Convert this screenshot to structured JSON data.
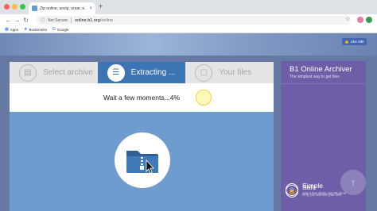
{
  "browser": {
    "tab_title": "Zip online, unzip, unrar, e...",
    "tab_close": "×",
    "new_tab": "+",
    "back": "←",
    "forward": "→",
    "reload": "↻",
    "security": "Not Secure",
    "url_host": "online.b1.org",
    "url_path": "/online",
    "star": "☆",
    "profile_initial": "",
    "bookmarks": [
      {
        "label": "Apps",
        "icon": "▦"
      },
      {
        "label": "Bookmarks",
        "icon": "★"
      },
      {
        "label": "Google",
        "icon": "G"
      }
    ]
  },
  "page": {
    "like_label": "Like 29K",
    "steps": [
      {
        "label": "Select archive",
        "icon": "▤",
        "active": false
      },
      {
        "label": "Extracting ...",
        "icon": "☰",
        "active": true
      },
      {
        "label": "Your files",
        "icon": "▢",
        "active": false
      }
    ],
    "status": "Wait a few moments...4%",
    "progress_percent": 4
  },
  "sidebar": {
    "title": "B1 Online Archiver",
    "subtitle": "The simplest way to get files",
    "features": [
      {
        "name": "Simple",
        "desc": "Just a few clicks and it's done",
        "icon": "☆"
      },
      {
        "name": "Safe",
        "desc": "Only you will see your files",
        "icon": "🔒"
      }
    ],
    "scroll_top_icon": "↑"
  },
  "colors": {
    "active_step": "#3d74b3",
    "sidebar": "#6e5ea8",
    "content_blue": "#6f9ccf"
  }
}
